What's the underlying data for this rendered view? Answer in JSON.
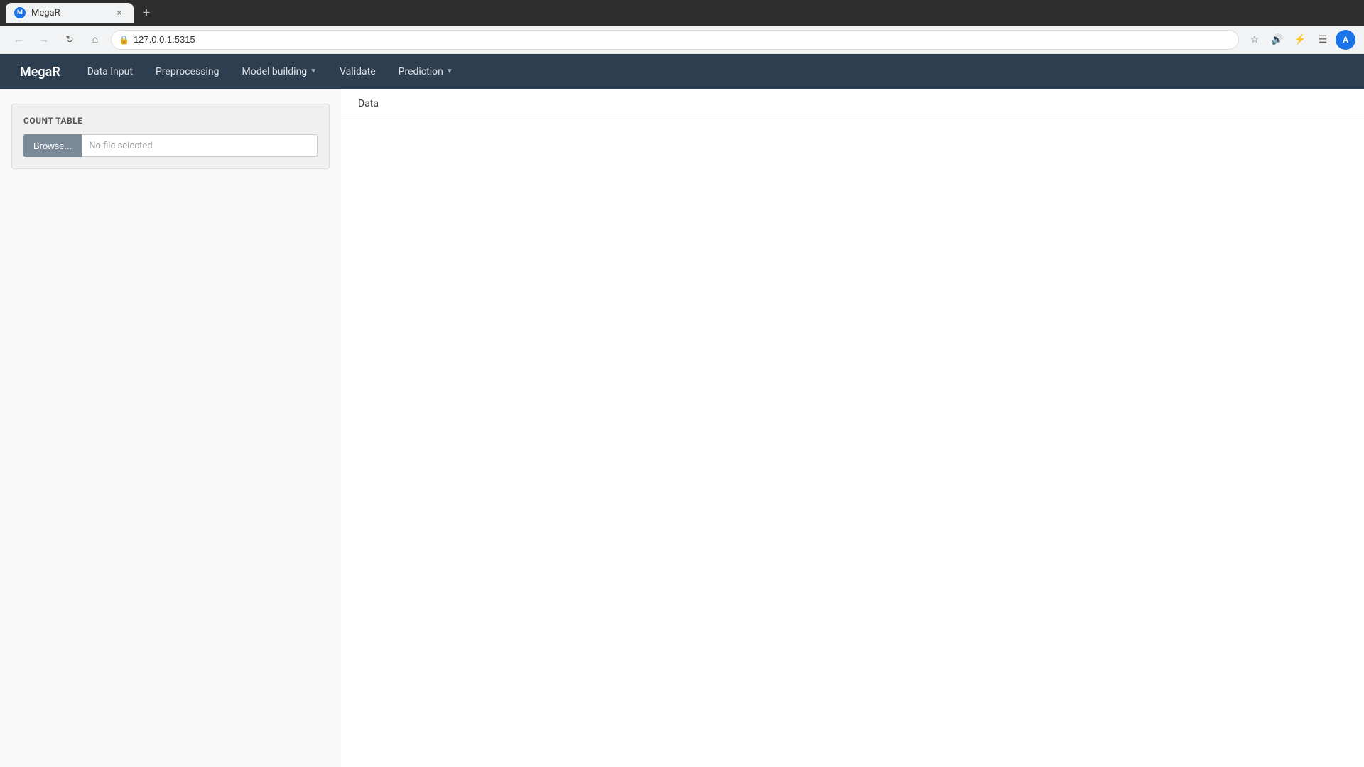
{
  "browser": {
    "tab": {
      "favicon_label": "M",
      "title": "MegaR",
      "close_label": "×"
    },
    "new_tab_label": "+",
    "toolbar": {
      "back_label": "←",
      "forward_label": "→",
      "reload_label": "↻",
      "home_label": "⌂",
      "address": "127.0.0.1:5315",
      "bookmark_label": "☆",
      "volume_label": "🔊",
      "extensions_label": "⚡",
      "menu_label": "☰",
      "user_avatar_label": "A"
    }
  },
  "app": {
    "brand": "MegaR",
    "nav_items": [
      {
        "id": "data-input",
        "label": "Data Input",
        "has_dropdown": false
      },
      {
        "id": "preprocessing",
        "label": "Preprocessing",
        "has_dropdown": false
      },
      {
        "id": "model-building",
        "label": "Model building",
        "has_dropdown": true
      },
      {
        "id": "validate",
        "label": "Validate",
        "has_dropdown": false
      },
      {
        "id": "prediction",
        "label": "Prediction",
        "has_dropdown": true
      }
    ]
  },
  "left_panel": {
    "title": "COUNT TABLE",
    "browse_label": "Browse...",
    "file_placeholder": "No file selected"
  },
  "right_panel": {
    "tabs": [
      {
        "id": "data",
        "label": "Data",
        "active": true
      }
    ]
  }
}
